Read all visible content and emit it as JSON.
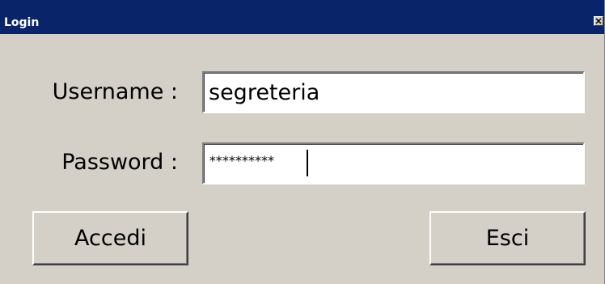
{
  "window": {
    "title": "Login",
    "close_icon": "close-x-icon"
  },
  "form": {
    "username_label": "Username :",
    "username_value": "segreteria",
    "password_label": "Password :",
    "password_value": "**********"
  },
  "buttons": {
    "login_label": "Accedi",
    "exit_label": "Esci"
  },
  "colors": {
    "titlebar": "#0a246a",
    "window_bg": "#d4d0c8"
  }
}
